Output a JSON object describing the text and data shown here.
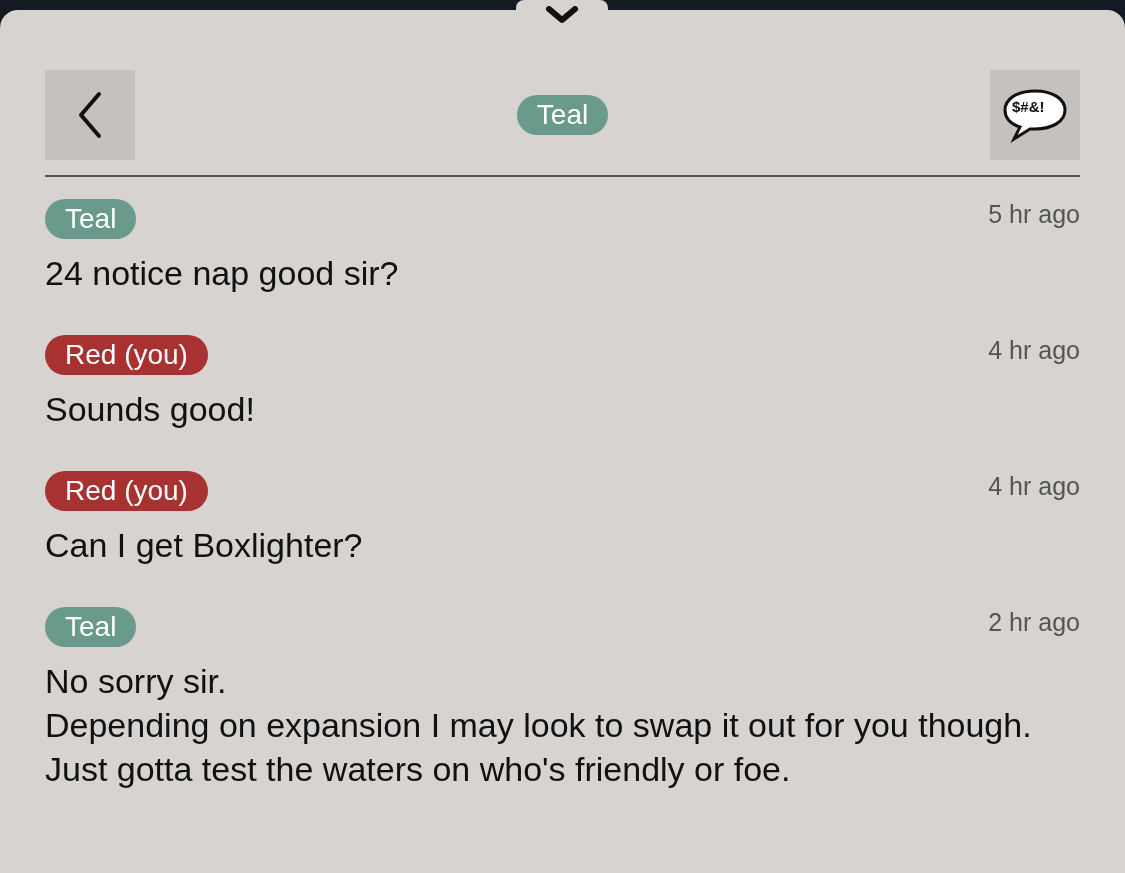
{
  "header": {
    "title_badge": {
      "label": "Teal",
      "color": "#6a9a8b"
    },
    "profanity_button": {
      "label": "$#&!"
    }
  },
  "messages": [
    {
      "sender": "Teal",
      "color": "#6a9a8b",
      "time": "5 hr ago",
      "text": "24 notice nap good sir?"
    },
    {
      "sender": "Red (you)",
      "color": "#a83232",
      "time": "4 hr ago",
      "text": "Sounds good!"
    },
    {
      "sender": "Red (you)",
      "color": "#a83232",
      "time": "4 hr ago",
      "text": "Can I get Boxlighter?"
    },
    {
      "sender": "Teal",
      "color": "#6a9a8b",
      "time": "2 hr ago",
      "text": "No sorry sir.\nDepending on expansion I may look to swap it out for you though. Just gotta test the waters on who's friendly or foe."
    }
  ]
}
